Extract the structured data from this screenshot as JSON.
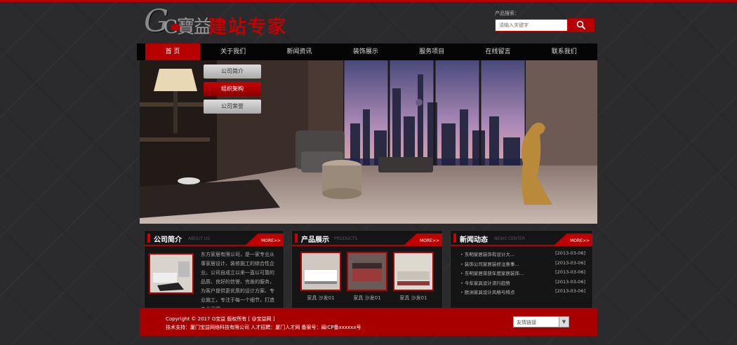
{
  "header": {
    "logo_text_1": "G寶益",
    "logo_text_2": "建站专家",
    "search_label": "产品搜索：",
    "search_placeholder": "请输入关键字"
  },
  "nav": {
    "items": [
      "首 页",
      "关于我们",
      "新闻资讯",
      "装饰展示",
      "服务项目",
      "在线留言",
      "联系我们"
    ],
    "active_index": 0
  },
  "banner": {
    "dropdown": [
      "公司简介",
      "组织架构",
      "公司荣誉"
    ],
    "highlight_index": 1
  },
  "about": {
    "title": "公司简介",
    "subtitle": "ABOUT US",
    "more": "MORE>>",
    "text": "东方家居有限公司，是一家专业从事家居设计、装修施工的综合性企业。公司自成立以来一直以可靠的品质、良好的信誉、完善的服务，为客户提供更优质的设计方案、专业施工，专注于每一个细节，打造专业品牌。"
  },
  "products": {
    "title": "产品展示",
    "subtitle": "PRODUCTS",
    "more": "MORE>>",
    "items": [
      "家具 沙发01",
      "家具 沙发01",
      "家具 沙发01"
    ]
  },
  "news": {
    "title": "新闻动态",
    "subtitle": "NEWS CENTER",
    "more": "MORE>>",
    "items": [
      {
        "title": "东明家居装饰有设计大...",
        "date": "[2013-03-06]"
      },
      {
        "title": "装饰公司家居装修注意事...",
        "date": "[2013-03-06]"
      },
      {
        "title": "东明家居荣获年度家居装饰...",
        "date": "[2013-03-06]"
      },
      {
        "title": "今年家具设计流行趋势",
        "date": "[2013-03-06]"
      },
      {
        "title": "欧洲家具设计风格与特点",
        "date": "[2013-03-06]"
      }
    ]
  },
  "footer": {
    "copyright": "Copyright © 2017 G宝益 版权所有 [ @宝益网 ]",
    "line2": "技术支持：厦门宝益网络科技有限公司  人才招聘：厦门人才网  备案号：闽ICP备xxxxxx号",
    "links_select": "友情链接"
  },
  "colors": {
    "accent": "#b80000",
    "background": "#2b2b2d",
    "nav_bg": "#050505"
  }
}
